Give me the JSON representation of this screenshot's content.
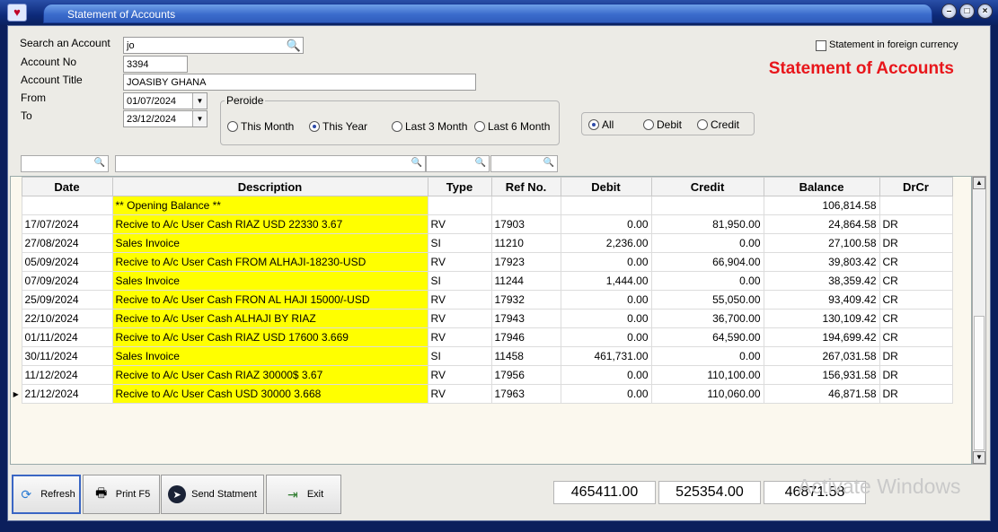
{
  "window": {
    "title": "Statement of Accounts"
  },
  "form": {
    "search_label": "Search an Account",
    "search_value": "jo",
    "account_no_label": "Account No",
    "account_no": "3394",
    "account_title_label": "Account Title",
    "account_title": "JOASIBY GHANA",
    "from_label": "From",
    "from_date": "01/07/2024",
    "to_label": "To",
    "to_date": "23/12/2024",
    "foreign_currency_label": "Statement in foreign currency",
    "heading": "Statement of Accounts"
  },
  "periode": {
    "title": "Peroide",
    "options": [
      "This Month",
      "This Year",
      "Last 3 Month",
      "Last 6 Month"
    ],
    "selected": "This Year"
  },
  "filter_type": {
    "options": [
      "All",
      "Debit",
      "Credit"
    ],
    "selected": "All"
  },
  "grid": {
    "columns": [
      "Date",
      "Description",
      "Type",
      "Ref No.",
      "Debit",
      "Credit",
      "Balance",
      "DrCr"
    ],
    "rows": [
      [
        "",
        "** Opening Balance **",
        "",
        "",
        "",
        "",
        "106,814.58",
        ""
      ],
      [
        "17/07/2024",
        "Recive to A/c User Cash RIAZ USD 22330 3.67",
        "RV",
        "17903",
        "0.00",
        "81,950.00",
        "24,864.58",
        "DR"
      ],
      [
        "27/08/2024",
        "Sales Invoice",
        "SI",
        "11210",
        "2,236.00",
        "0.00",
        "27,100.58",
        "DR"
      ],
      [
        "05/09/2024",
        "Recive to A/c User Cash FROM ALHAJI-18230-USD",
        "RV",
        "17923",
        "0.00",
        "66,904.00",
        "39,803.42",
        "CR"
      ],
      [
        "07/09/2024",
        "Sales Invoice",
        "SI",
        "11244",
        "1,444.00",
        "0.00",
        "38,359.42",
        "CR"
      ],
      [
        "25/09/2024",
        "Recive to A/c User Cash FRON AL HAJI 15000/-USD",
        "RV",
        "17932",
        "0.00",
        "55,050.00",
        "93,409.42",
        "CR"
      ],
      [
        "22/10/2024",
        "Recive to A/c User Cash ALHAJI BY RIAZ",
        "RV",
        "17943",
        "0.00",
        "36,700.00",
        "130,109.42",
        "CR"
      ],
      [
        "01/11/2024",
        "Recive to A/c User Cash RIAZ USD 17600  3.669",
        "RV",
        "17946",
        "0.00",
        "64,590.00",
        "194,699.42",
        "CR"
      ],
      [
        "30/11/2024",
        "Sales Invoice",
        "SI",
        "11458",
        "461,731.00",
        "0.00",
        "267,031.58",
        "DR"
      ],
      [
        "11/12/2024",
        "Recive to A/c User Cash RIAZ 30000$ 3.67",
        "RV",
        "17956",
        "0.00",
        "110,100.00",
        "156,931.58",
        "DR"
      ],
      [
        "21/12/2024",
        "Recive to A/c User Cash USD 30000 3.668",
        "RV",
        "17963",
        "0.00",
        "110,060.00",
        "46,871.58",
        "DR"
      ]
    ],
    "current_row": 10
  },
  "buttons": {
    "refresh": "Refresh",
    "print": "Print F5",
    "send": "Send Statment",
    "exit": "Exit"
  },
  "totals": {
    "debit": "465411.00",
    "credit": "525354.00",
    "balance": "46871.58"
  },
  "watermark": "Activate Windows",
  "colors": {
    "heading": "#e8161b",
    "description_highlight": "#ffff00",
    "titlebar": "#0d2a7a"
  }
}
